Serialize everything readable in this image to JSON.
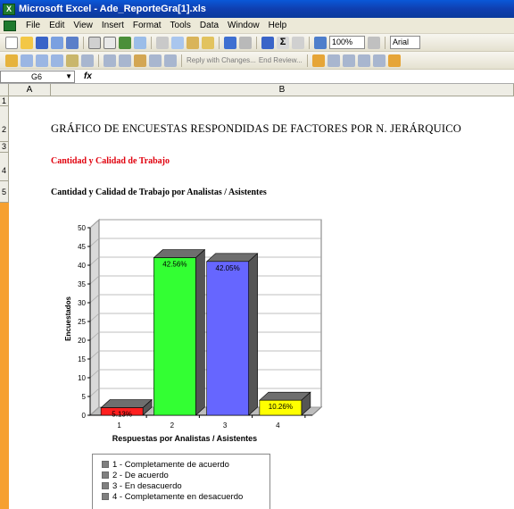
{
  "window": {
    "title": "Microsoft Excel - Ade_ReporteGra[1].xls"
  },
  "menu": [
    "File",
    "Edit",
    "View",
    "Insert",
    "Format",
    "Tools",
    "Data",
    "Window",
    "Help"
  ],
  "toolbar": {
    "zoom": "100%",
    "font": "Arial",
    "reply_text": "Reply with Changes...",
    "end_review": "End Review..."
  },
  "formula": {
    "cell": "G6",
    "fx": "fx"
  },
  "columns": [
    "A",
    "B"
  ],
  "rows": [
    "1",
    "2",
    "3",
    "4",
    "5"
  ],
  "sheet": {
    "title": "GRÁFICO DE ENCUESTAS RESPONDIDAS DE FACTORES POR N. JERÁRQUICO",
    "section": "Cantidad y Calidad de Trabajo",
    "chart_heading": "Cantidad y Calidad de Trabajo por Analistas / Asistentes"
  },
  "chart_data": {
    "type": "bar",
    "categories": [
      "1",
      "2",
      "3",
      "4"
    ],
    "values": [
      2,
      42,
      41,
      4
    ],
    "labels": [
      "5.13%",
      "42.56%",
      "42.05%",
      "10.26%"
    ],
    "colors": [
      "#ff1f1f",
      "#33ff33",
      "#6666ff",
      "#ffff00"
    ],
    "ylabel": "Encuestados",
    "xlabel": "Respuestas por Analistas / Asistentes",
    "ylim": [
      0,
      50
    ],
    "yticks": [
      0,
      5,
      10,
      15,
      20,
      25,
      30,
      35,
      40,
      45,
      50
    ],
    "legend": [
      "1 - Completamente de acuerdo",
      "2 - De acuerdo",
      "3 - En desacuerdo",
      "4 - Completamente en desacuerdo"
    ]
  }
}
